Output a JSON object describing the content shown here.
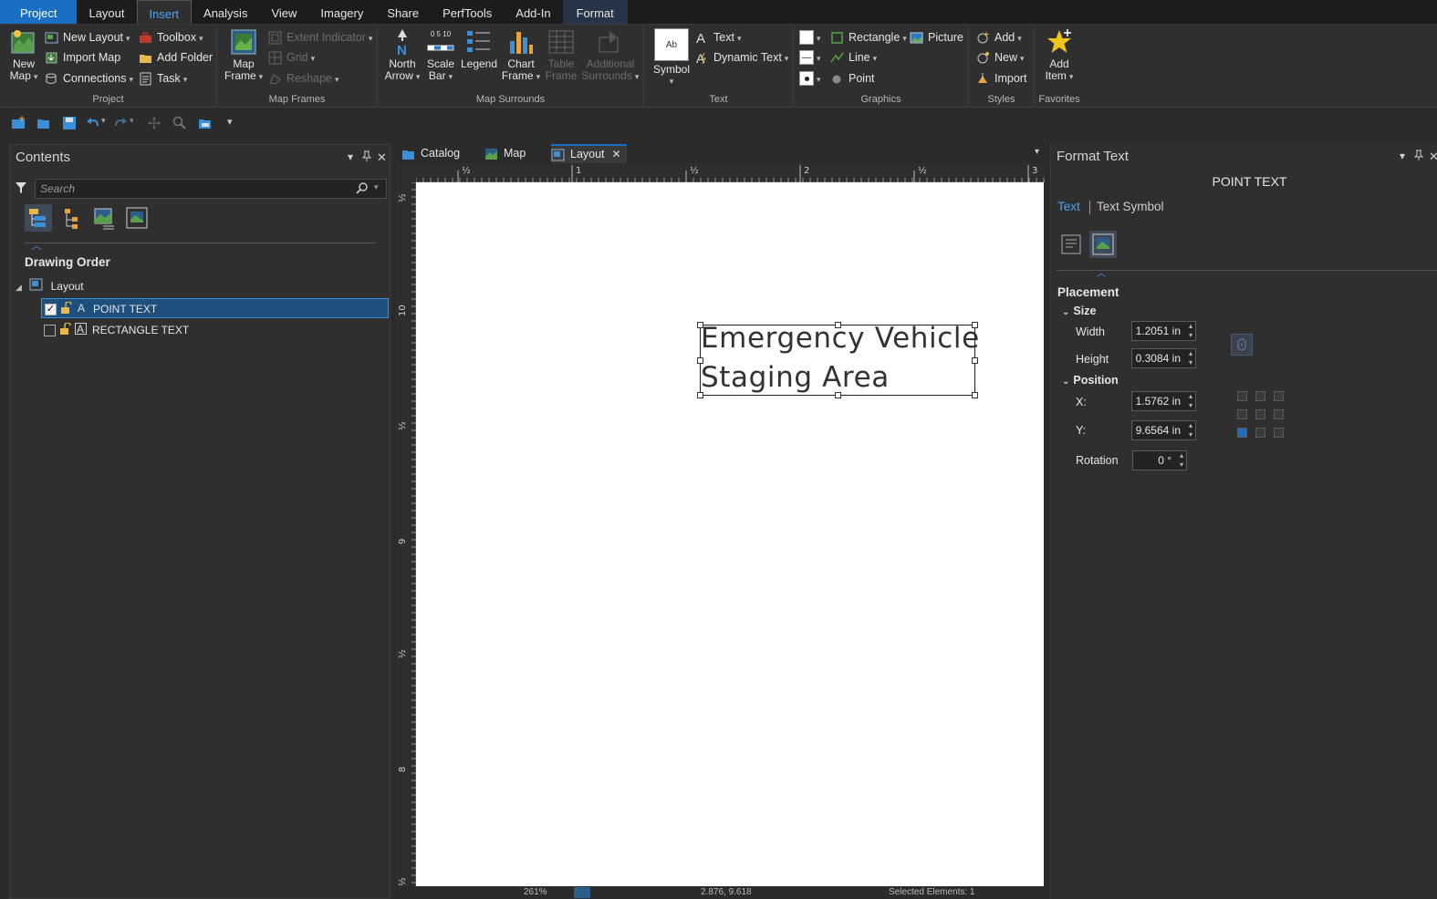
{
  "ribbon_tabs": [
    {
      "label": "Project",
      "kind": "project"
    },
    {
      "label": "Layout",
      "kind": "normal"
    },
    {
      "label": "Insert",
      "kind": "active"
    },
    {
      "label": "Analysis",
      "kind": "normal"
    },
    {
      "label": "View",
      "kind": "normal"
    },
    {
      "label": "Imagery",
      "kind": "normal"
    },
    {
      "label": "Share",
      "kind": "normal"
    },
    {
      "label": "PerfTools",
      "kind": "normal"
    },
    {
      "label": "Add-In",
      "kind": "normal"
    },
    {
      "label": "Format",
      "kind": "context"
    }
  ],
  "ribbon": {
    "project": {
      "group_label": "Project",
      "new_map": "New\nMap",
      "new_layout": "New Layout",
      "import_map": "Import Map",
      "connections": "Connections",
      "toolbox": "Toolbox",
      "add_folder": "Add Folder",
      "task": "Task"
    },
    "map_frames": {
      "group_label": "Map Frames",
      "map_frame": "Map\nFrame",
      "extent_indicator": "Extent Indicator",
      "grid": "Grid",
      "reshape": "Reshape"
    },
    "map_surrounds": {
      "group_label": "Map Surrounds",
      "north_arrow": "North\nArrow",
      "scale_bar": "Scale\nBar",
      "scale_bar_ticks": "0  5  10",
      "legend": "Legend",
      "chart_frame": "Chart\nFrame",
      "table_frame": "Table\nFrame",
      "additional_surrounds": "Additional\nSurrounds"
    },
    "text": {
      "group_label": "Text",
      "symbol": "Symbol",
      "symbol_preview": "Ab",
      "text": "Text",
      "dynamic_text": "Dynamic Text"
    },
    "graphics": {
      "group_label": "Graphics",
      "rectangle": "Rectangle",
      "picture": "Picture",
      "line": "Line",
      "point": "Point"
    },
    "styles": {
      "group_label": "Styles",
      "add": "Add",
      "new": "New",
      "import": "Import"
    },
    "favorites": {
      "group_label": "Favorites",
      "add_item": "Add\nItem"
    }
  },
  "contents": {
    "title": "Contents",
    "search_placeholder": "Search",
    "section_title": "Drawing Order",
    "root": "Layout",
    "items": [
      {
        "label": "POINT TEXT",
        "checked": true,
        "selected": true
      },
      {
        "label": "RECTANGLE TEXT",
        "checked": false,
        "selected": false
      }
    ]
  },
  "view_tabs": [
    {
      "label": "Catalog"
    },
    {
      "label": "Map"
    },
    {
      "label": "Layout",
      "active": true
    }
  ],
  "ruler": {
    "h_labels": [
      "½",
      "1",
      "½",
      "2",
      "½",
      "3"
    ],
    "v_labels": [
      "½",
      "10",
      "½",
      "9",
      "½",
      "8",
      "½"
    ]
  },
  "layout": {
    "text_line1": "Emergency Vehicle",
    "text_line2": "Staging Area"
  },
  "status": {
    "zoom": "261%",
    "coords": "2.876, 9.618",
    "selected": "Selected Elements: 1"
  },
  "format_pane": {
    "title": "Format Text",
    "heading": "POINT TEXT",
    "tabs": [
      "Text",
      "Text Symbol"
    ],
    "placement": "Placement",
    "size": "Size",
    "width_label": "Width",
    "width_value": "1.2051 in",
    "height_label": "Height",
    "height_value": "0.3084 in",
    "position": "Position",
    "x_label": "X:",
    "x_value": "1.5762 in",
    "y_label": "Y:",
    "y_value": "9.6564 in",
    "rotation_label": "Rotation",
    "rotation_value": "0 °"
  },
  "colors": {
    "accent": "#1a6fc4",
    "active_tab_text": "#49a5ff",
    "selection": "#1e4e7c"
  }
}
